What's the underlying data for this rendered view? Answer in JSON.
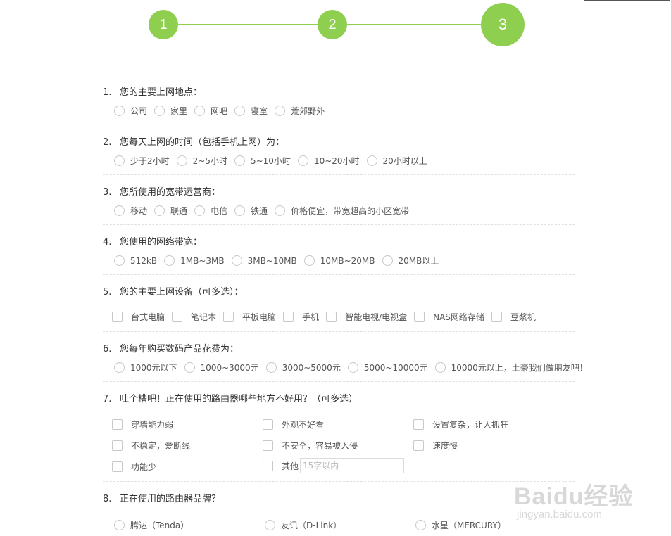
{
  "steps": [
    "1",
    "2",
    "3"
  ],
  "accent_color": "#8fcf4f",
  "questions": [
    {
      "num": "1.",
      "title": "您的主要上网地点：",
      "type": "radio",
      "options": [
        "公司",
        "家里",
        "网吧",
        "寝室",
        "荒郊野外"
      ]
    },
    {
      "num": "2.",
      "title": "您每天上网的时间（包括手机上网）为：",
      "type": "radio",
      "options": [
        "少于2小时",
        "2~5小时",
        "5~10小时",
        "10~20小时",
        "20小时以上"
      ]
    },
    {
      "num": "3.",
      "title": "您所使用的宽带运营商：",
      "type": "radio",
      "options": [
        "移动",
        "联通",
        "电信",
        "铁通",
        "价格便宜，带宽超高的小区宽带"
      ]
    },
    {
      "num": "4.",
      "title": "您使用的网络带宽：",
      "type": "radio",
      "options": [
        "512kB",
        "1MB~3MB",
        "3MB~10MB",
        "10MB~20MB",
        "20MB以上"
      ]
    },
    {
      "num": "5.",
      "title": "您的主要上网设备（可多选）：",
      "type": "checkbox",
      "options": [
        "台式电脑",
        "笔记本",
        "平板电脑",
        "手机",
        "智能电视/电视盒",
        "NAS网络存储",
        "豆浆机"
      ]
    },
    {
      "num": "6.",
      "title": "您每年购买数码产品花费为：",
      "type": "radio",
      "options": [
        "1000元以下",
        "1000~3000元",
        "3000~5000元",
        "5000~10000元",
        "10000元以上，土豪我们做朋友吧！"
      ]
    },
    {
      "num": "7.",
      "title": "吐个槽吧！正在使用的路由器哪些地方不好用？（可多选）",
      "type": "checkbox-grid",
      "options": [
        "穿墙能力弱",
        "外观不好看",
        "设置复杂，让人抓狂",
        "不稳定，爱断线",
        "不安全，容易被入侵",
        "速度慢",
        "功能少",
        "其他"
      ],
      "other_placeholder": "15字以内"
    },
    {
      "num": "8.",
      "title": "正在使用的路由器品牌？",
      "type": "radio",
      "options": [
        "腾达（Tenda）",
        "友讯（D-Link）",
        "水星（MERCURY）"
      ]
    }
  ],
  "watermark": {
    "logo": "Baidu经验",
    "url": "jingyan.baidu.com"
  }
}
